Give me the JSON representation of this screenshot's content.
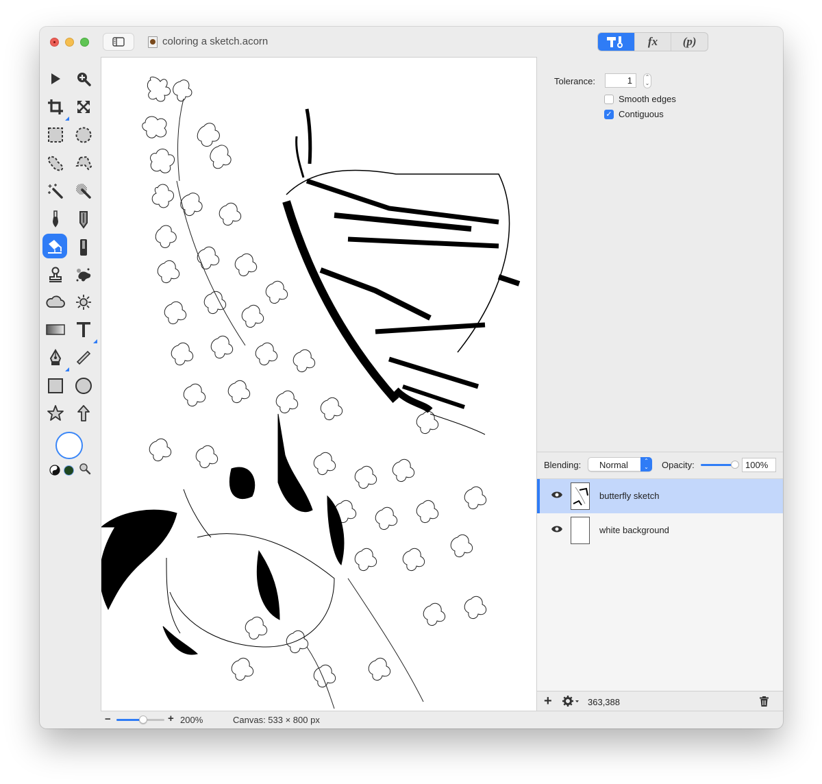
{
  "window": {
    "title": "coloring a sketch.acorn",
    "traffic_lights": [
      "close",
      "minimize",
      "zoom"
    ]
  },
  "toolbar": {
    "segments": [
      {
        "name": "tools",
        "label": "",
        "icon": "hammer-brush-icon",
        "active": true
      },
      {
        "name": "effects",
        "label": "fx",
        "active": false
      },
      {
        "name": "properties",
        "label": "(p)",
        "active": false
      }
    ]
  },
  "tools": [
    {
      "name": "select",
      "icon": "arrow-pointer-icon"
    },
    {
      "name": "zoom",
      "icon": "zoom-in-icon"
    },
    {
      "name": "crop",
      "icon": "crop-icon",
      "has_submenu": true
    },
    {
      "name": "transform",
      "icon": "expand-arrows-icon"
    },
    {
      "name": "rect-select",
      "icon": "rect-marquee-icon"
    },
    {
      "name": "ellipse-select",
      "icon": "ellipse-marquee-icon"
    },
    {
      "name": "lasso",
      "icon": "lasso-icon"
    },
    {
      "name": "polygon-lasso",
      "icon": "polygon-lasso-icon"
    },
    {
      "name": "magic-wand",
      "icon": "magic-wand-icon"
    },
    {
      "name": "instant-alpha",
      "icon": "instant-alpha-icon"
    },
    {
      "name": "brush",
      "icon": "brush-icon"
    },
    {
      "name": "pencil",
      "icon": "pencil-icon"
    },
    {
      "name": "paint-bucket",
      "icon": "paint-bucket-icon",
      "active": true
    },
    {
      "name": "eraser",
      "icon": "eraser-icon"
    },
    {
      "name": "clone",
      "icon": "stamp-icon"
    },
    {
      "name": "smudge",
      "icon": "splatter-icon"
    },
    {
      "name": "burn",
      "icon": "cloud-icon"
    },
    {
      "name": "dodge",
      "icon": "sun-icon"
    },
    {
      "name": "gradient",
      "icon": "gradient-icon"
    },
    {
      "name": "text",
      "icon": "text-icon",
      "has_submenu": true
    },
    {
      "name": "pen",
      "icon": "pen-nib-icon",
      "has_submenu": true
    },
    {
      "name": "line",
      "icon": "line-icon"
    },
    {
      "name": "rectangle",
      "icon": "rectangle-shape-icon"
    },
    {
      "name": "oval",
      "icon": "oval-shape-icon"
    },
    {
      "name": "star",
      "icon": "star-shape-icon"
    },
    {
      "name": "arrow",
      "icon": "arrow-shape-icon"
    }
  ],
  "colors": {
    "fill": "#ffffff",
    "secondary": "#1e4620",
    "accent": "#2f7cf6",
    "selected_row": "#c3d7fb"
  },
  "inspector": {
    "tolerance_label": "Tolerance:",
    "tolerance_value": "1",
    "smooth_edges_label": "Smooth edges",
    "smooth_edges_checked": false,
    "contiguous_label": "Contiguous",
    "contiguous_checked": true
  },
  "layers": {
    "blending_label": "Blending:",
    "blending_value": "Normal",
    "opacity_label": "Opacity:",
    "opacity_value": "100%",
    "opacity_fraction": 1.0,
    "items": [
      {
        "name": "butterfly sketch",
        "visible": true,
        "selected": true
      },
      {
        "name": "white background",
        "visible": true,
        "selected": false
      }
    ],
    "coords": "363,388"
  },
  "status": {
    "zoom_minus": "−",
    "zoom_plus": "+",
    "zoom_level": "200%",
    "zoom_fraction": 0.55,
    "canvas_size": "Canvas: 533 × 800 px"
  }
}
